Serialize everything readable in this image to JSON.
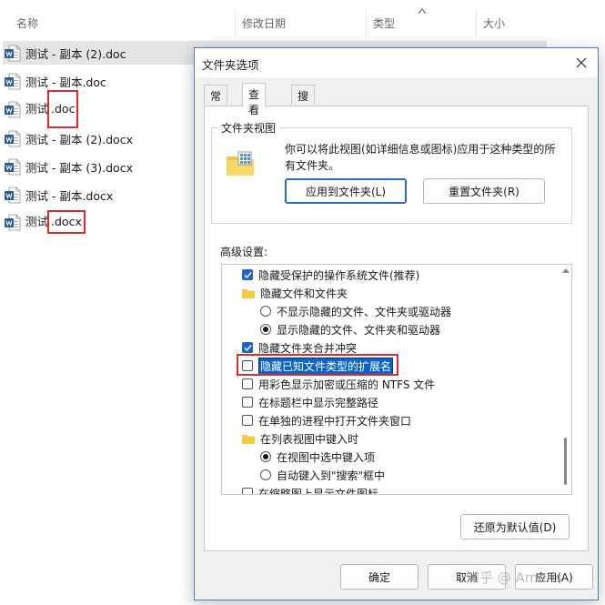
{
  "explorer": {
    "columns": {
      "name": "名称",
      "modified": "修改日期",
      "type": "类型",
      "size": "大小"
    },
    "files": [
      {
        "name": "测试 - 副本 (2).doc",
        "selected": true
      },
      {
        "name": "测试 - 副本.doc"
      },
      {
        "name_pre": "测试",
        "name_ext": ".doc",
        "highlighted": true
      },
      {
        "name": "测试 - 副本 (2).docx"
      },
      {
        "name": "测试 - 副本 (3).docx"
      },
      {
        "name": "测试 - 副本.docx"
      },
      {
        "name_pre": "测试",
        "name_ext": ".docx",
        "highlighted": true
      }
    ]
  },
  "dialog": {
    "title": "文件夹选项",
    "tabs": [
      "常规",
      "查看",
      "搜索"
    ],
    "active_tab": "查看",
    "folder_view": {
      "title": "文件夹视图",
      "description": "你可以将此视图(如详细信息或图标)应用于这种类型的所有文件夹。",
      "apply_button": "应用到文件夹(L)",
      "reset_button": "重置文件夹(R)"
    },
    "advanced_label": "高级设置:",
    "advanced_items": [
      {
        "kind": "checkbox",
        "checked": true,
        "label": "隐藏受保护的操作系统文件(推荐)"
      },
      {
        "kind": "folder",
        "label": "隐藏文件和文件夹"
      },
      {
        "kind": "radio",
        "checked": false,
        "label": "不显示隐藏的文件、文件夹或驱动器"
      },
      {
        "kind": "radio",
        "checked": true,
        "label": "显示隐藏的文件、文件夹和驱动器"
      },
      {
        "kind": "checkbox",
        "checked": true,
        "label": "隐藏文件夹合并冲突"
      },
      {
        "kind": "checkbox",
        "checked": false,
        "label": "隐藏已知文件类型的扩展名",
        "highlighted": true
      },
      {
        "kind": "checkbox",
        "checked": false,
        "label": "用彩色显示加密或压缩的 NTFS 文件"
      },
      {
        "kind": "checkbox",
        "checked": false,
        "label": "在标题栏中显示完整路径"
      },
      {
        "kind": "checkbox",
        "checked": false,
        "label": "在单独的进程中打开文件夹窗口"
      },
      {
        "kind": "folder",
        "label": "在列表视图中键入时"
      },
      {
        "kind": "radio",
        "checked": true,
        "label": "在视图中选中键入项"
      },
      {
        "kind": "radio",
        "checked": false,
        "label": "自动键入到\"搜索\"框中"
      },
      {
        "kind": "checkbox",
        "checked": false,
        "label": "在缩略图上显示文件图标"
      }
    ],
    "restore_defaults": "还原为默认值(D)",
    "ok_button": "确定",
    "cancel_button": "取消",
    "apply_button": "应用(A)"
  },
  "watermark": "知乎 @ Amens",
  "colors": {
    "accent": "#1f66c3",
    "highlight_box": "#d32f2f",
    "dialog_bg": "#f0f0f0",
    "word_icon": "#2b579a"
  }
}
